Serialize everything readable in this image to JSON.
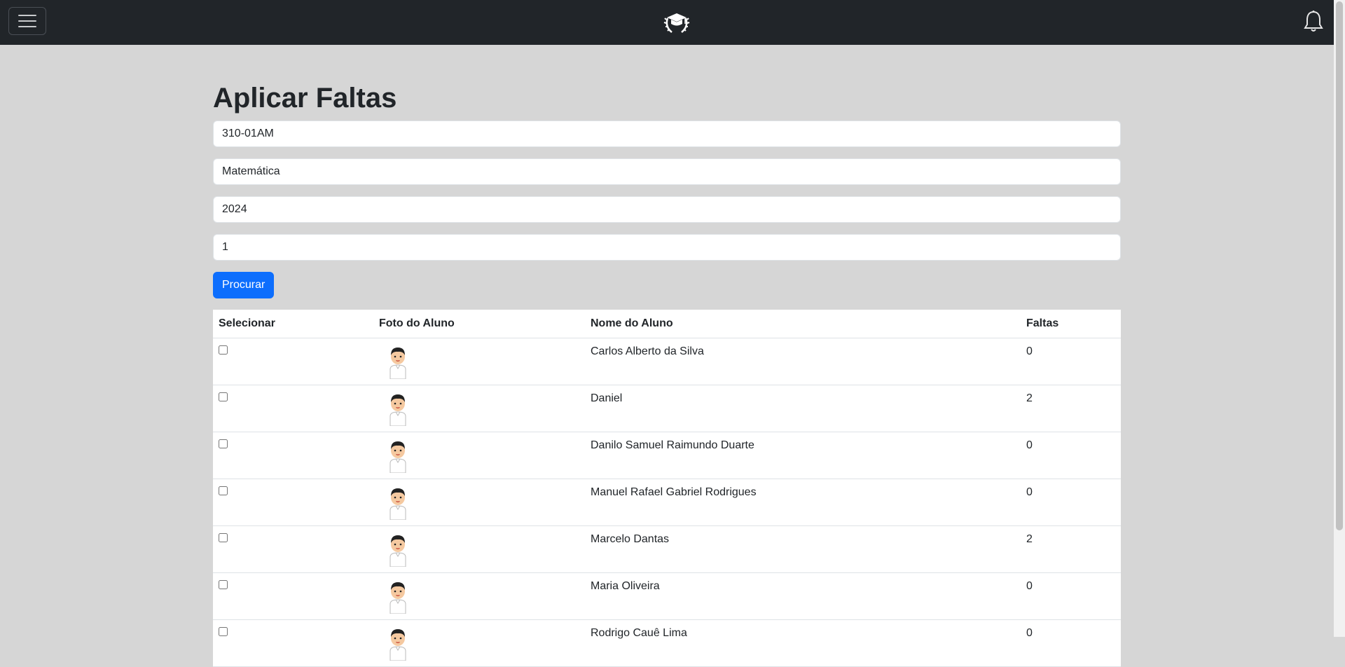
{
  "page": {
    "title": "Aplicar Faltas"
  },
  "navbar": {
    "menu_icon": "hamburger-menu-icon",
    "logo_icon": "graduation-cap-logo",
    "notification_icon": "bell-icon"
  },
  "form": {
    "turma": "310-01AM",
    "disciplina": "Matemática",
    "ano": "2024",
    "bimestre": "1",
    "search_button": "Procurar"
  },
  "table": {
    "headers": [
      "Selecionar",
      "Foto do Aluno",
      "Nome do Aluno",
      "Faltas"
    ],
    "rows": [
      {
        "name": "Carlos Alberto da Silva",
        "faltas": "0"
      },
      {
        "name": "Daniel",
        "faltas": "2"
      },
      {
        "name": "Danilo Samuel Raimundo Duarte",
        "faltas": "0"
      },
      {
        "name": "Manuel Rafael Gabriel Rodrigues",
        "faltas": "0"
      },
      {
        "name": "Marcelo Dantas",
        "faltas": "2"
      },
      {
        "name": "Maria Oliveira",
        "faltas": "0"
      },
      {
        "name": "Rodrigo Cauê Lima",
        "faltas": "0"
      }
    ]
  },
  "colors": {
    "navbar": "#212529",
    "background": "#d6d6d6",
    "primary": "#0d6efd"
  }
}
